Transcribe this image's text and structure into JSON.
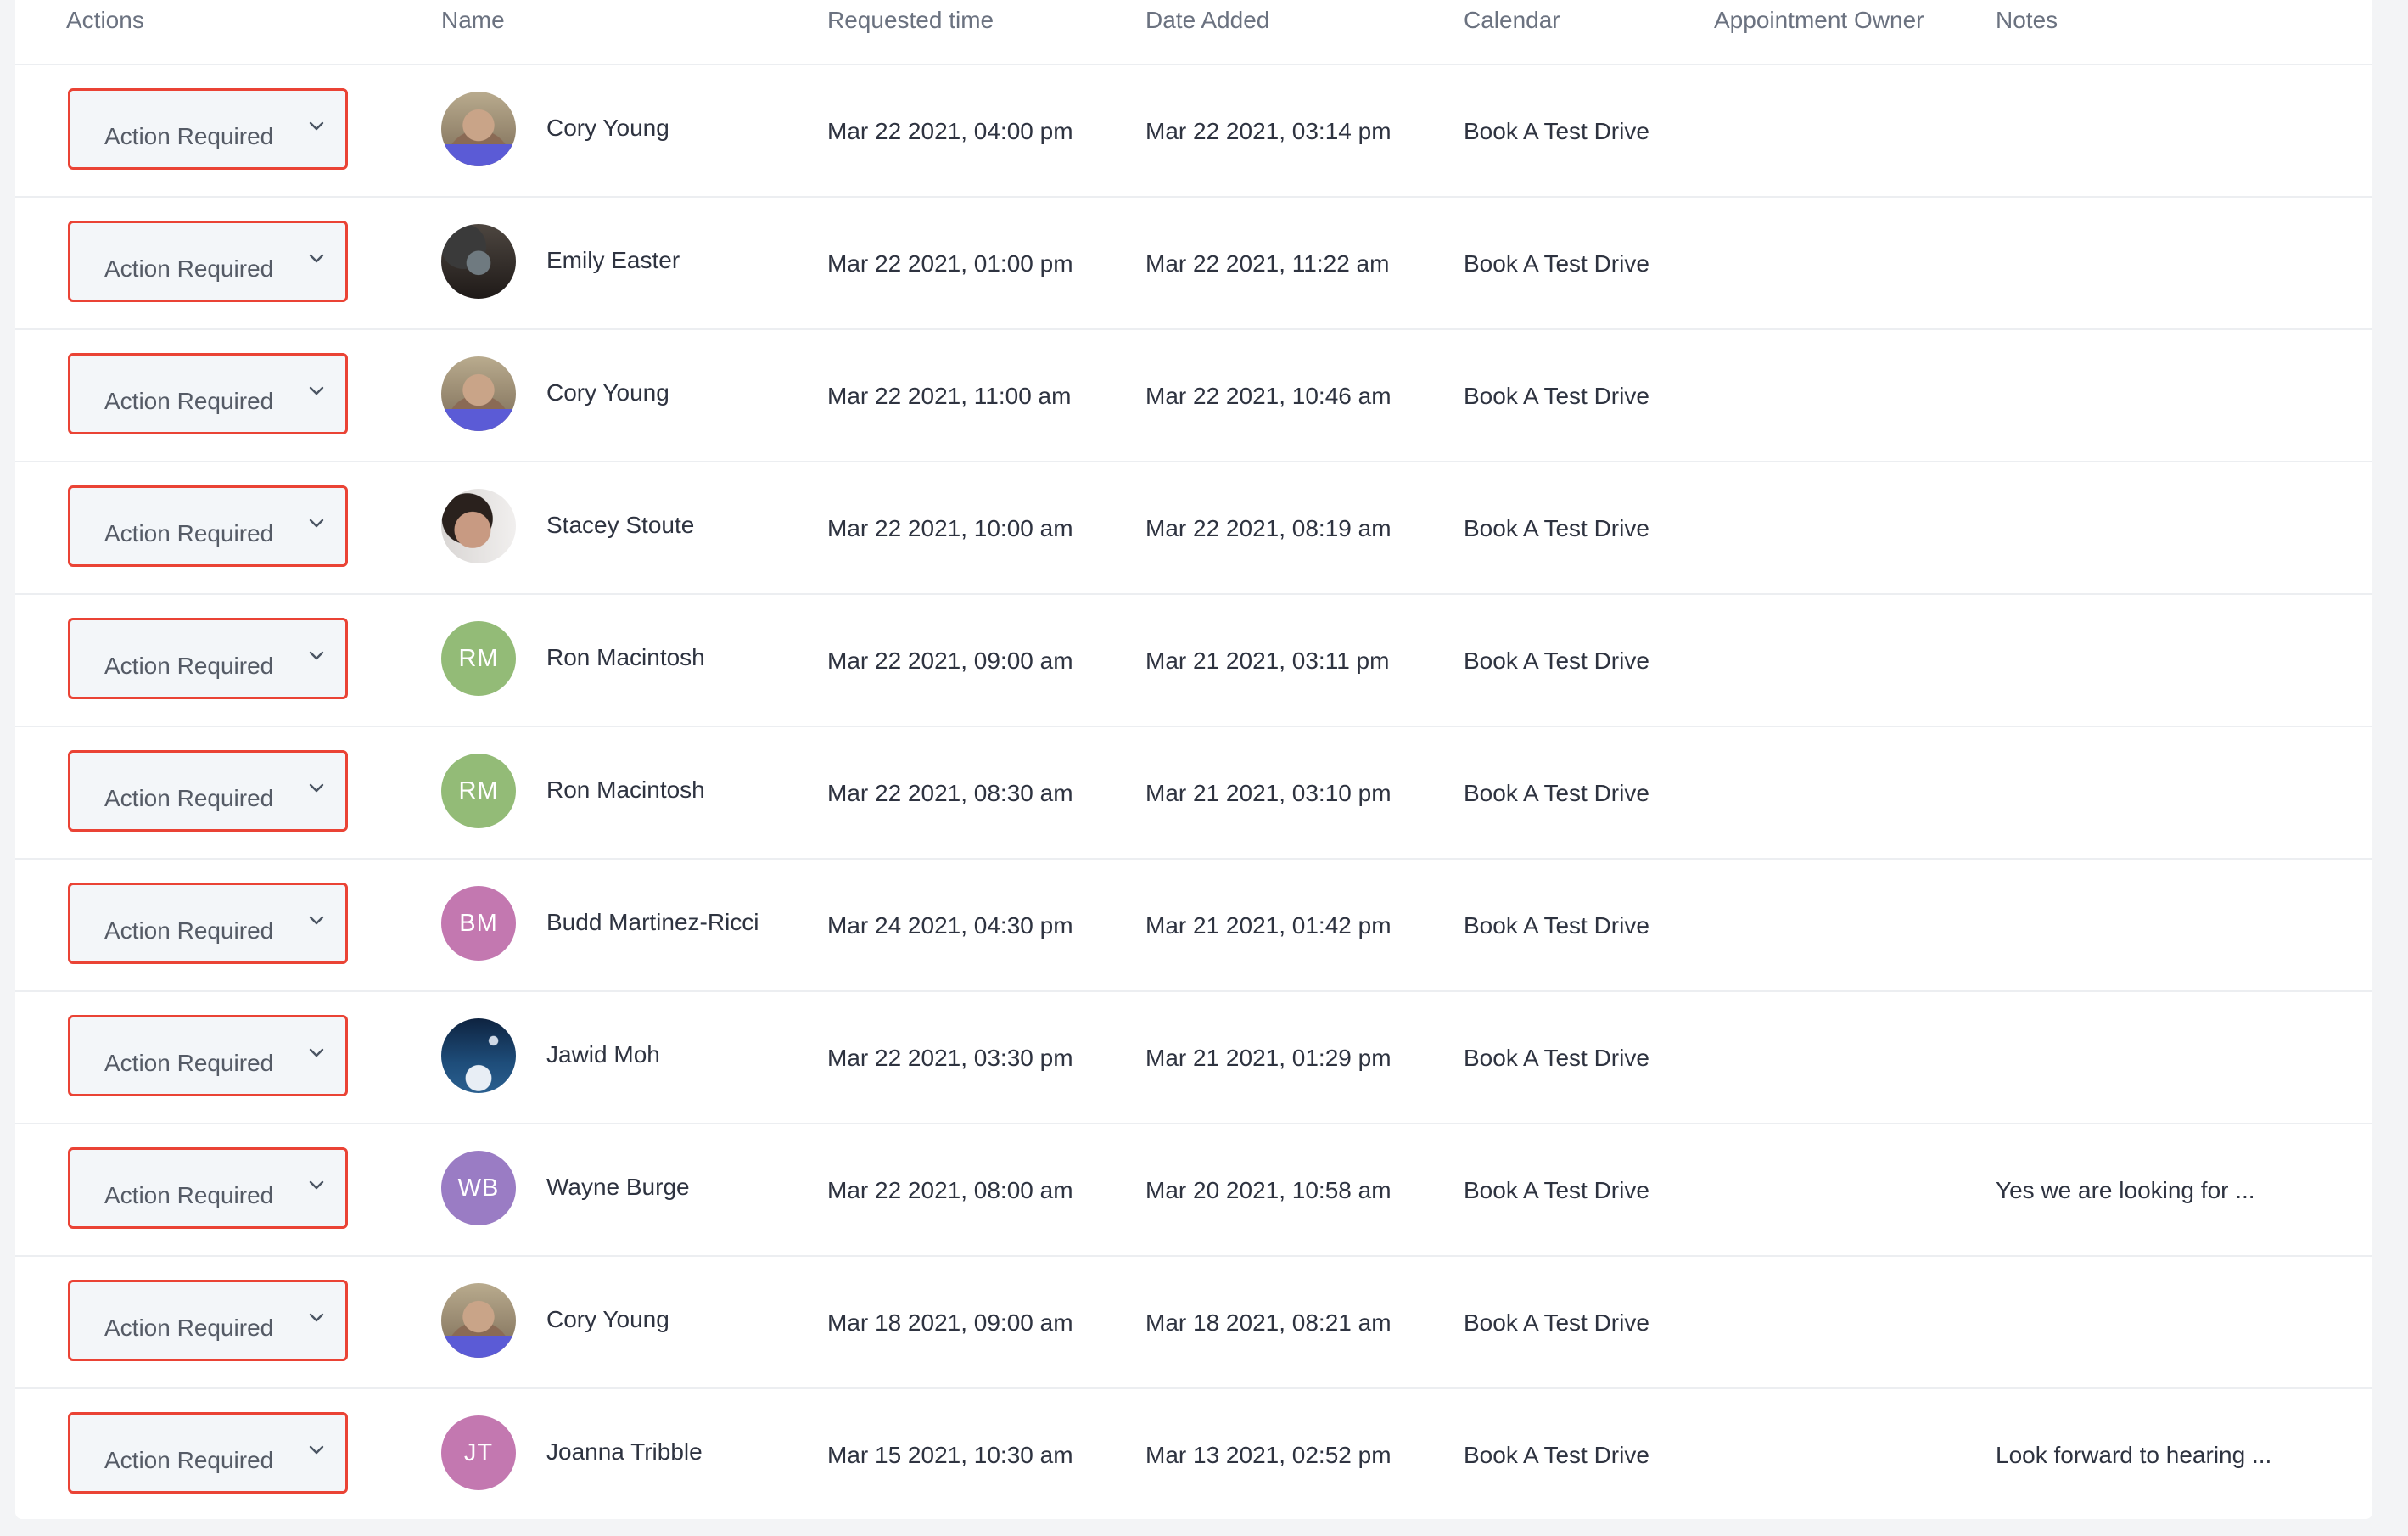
{
  "header": {
    "columns": [
      {
        "key": "actions",
        "label": "Actions"
      },
      {
        "key": "name",
        "label": "Name"
      },
      {
        "key": "requested",
        "label": "Requested time"
      },
      {
        "key": "added",
        "label": "Date Added"
      },
      {
        "key": "calendar",
        "label": "Calendar"
      },
      {
        "key": "owner",
        "label": "Appointment Owner"
      },
      {
        "key": "notes",
        "label": "Notes"
      }
    ]
  },
  "colors": {
    "action_border": "#ea4335",
    "avatar_rm": "#93bb77",
    "avatar_bm": "#c378b0",
    "avatar_wb": "#9a7cc4",
    "avatar_jt": "#c378b0"
  },
  "rows": [
    {
      "action": "Action Required",
      "name": "Cory Young",
      "avatar": {
        "type": "photo",
        "photo": "cory"
      },
      "requested": "Mar 22 2021, 04:00 pm",
      "added": "Mar 22 2021, 03:14 pm",
      "calendar": "Book A Test Drive",
      "owner": "",
      "notes": ""
    },
    {
      "action": "Action Required",
      "name": "Emily Easter",
      "avatar": {
        "type": "photo",
        "photo": "emily"
      },
      "requested": "Mar 22 2021, 01:00 pm",
      "added": "Mar 22 2021, 11:22 am",
      "calendar": "Book A Test Drive",
      "owner": "",
      "notes": ""
    },
    {
      "action": "Action Required",
      "name": "Cory Young",
      "avatar": {
        "type": "photo",
        "photo": "cory"
      },
      "requested": "Mar 22 2021, 11:00 am",
      "added": "Mar 22 2021, 10:46 am",
      "calendar": "Book A Test Drive",
      "owner": "",
      "notes": ""
    },
    {
      "action": "Action Required",
      "name": "Stacey Stoute",
      "avatar": {
        "type": "photo",
        "photo": "stacey"
      },
      "requested": "Mar 22 2021, 10:00 am",
      "added": "Mar 22 2021, 08:19 am",
      "calendar": "Book A Test Drive",
      "owner": "",
      "notes": ""
    },
    {
      "action": "Action Required",
      "name": "Ron Macintosh",
      "avatar": {
        "type": "initials",
        "initials": "RM",
        "color": "#93bb77"
      },
      "requested": "Mar 22 2021, 09:00 am",
      "added": "Mar 21 2021, 03:11 pm",
      "calendar": "Book A Test Drive",
      "owner": "",
      "notes": ""
    },
    {
      "action": "Action Required",
      "name": "Ron Macintosh",
      "avatar": {
        "type": "initials",
        "initials": "RM",
        "color": "#93bb77"
      },
      "requested": "Mar 22 2021, 08:30 am",
      "added": "Mar 21 2021, 03:10 pm",
      "calendar": "Book A Test Drive",
      "owner": "",
      "notes": ""
    },
    {
      "action": "Action Required",
      "name": "Budd Martinez-Ricci",
      "avatar": {
        "type": "initials",
        "initials": "BM",
        "color": "#c378b0"
      },
      "requested": "Mar 24 2021, 04:30 pm",
      "added": "Mar 21 2021, 01:42 pm",
      "calendar": "Book A Test Drive",
      "owner": "",
      "notes": ""
    },
    {
      "action": "Action Required",
      "name": "Jawid Moh",
      "avatar": {
        "type": "photo",
        "photo": "jawid"
      },
      "requested": "Mar 22 2021, 03:30 pm",
      "added": "Mar 21 2021, 01:29 pm",
      "calendar": "Book A Test Drive",
      "owner": "",
      "notes": ""
    },
    {
      "action": "Action Required",
      "name": "Wayne Burge",
      "avatar": {
        "type": "initials",
        "initials": "WB",
        "color": "#9a7cc4"
      },
      "requested": "Mar 22 2021, 08:00 am",
      "added": "Mar 20 2021, 10:58 am",
      "calendar": "Book A Test Drive",
      "owner": "",
      "notes": "Yes we are looking for ..."
    },
    {
      "action": "Action Required",
      "name": "Cory Young",
      "avatar": {
        "type": "photo",
        "photo": "cory"
      },
      "requested": "Mar 18 2021, 09:00 am",
      "added": "Mar 18 2021, 08:21 am",
      "calendar": "Book A Test Drive",
      "owner": "",
      "notes": ""
    },
    {
      "action": "Action Required",
      "name": "Joanna Tribble",
      "avatar": {
        "type": "initials",
        "initials": "JT",
        "color": "#c378b0"
      },
      "requested": "Mar 15 2021, 10:30 am",
      "added": "Mar 13 2021, 02:52 pm",
      "calendar": "Book A Test Drive",
      "owner": "",
      "notes": "Look forward to hearing ..."
    }
  ]
}
